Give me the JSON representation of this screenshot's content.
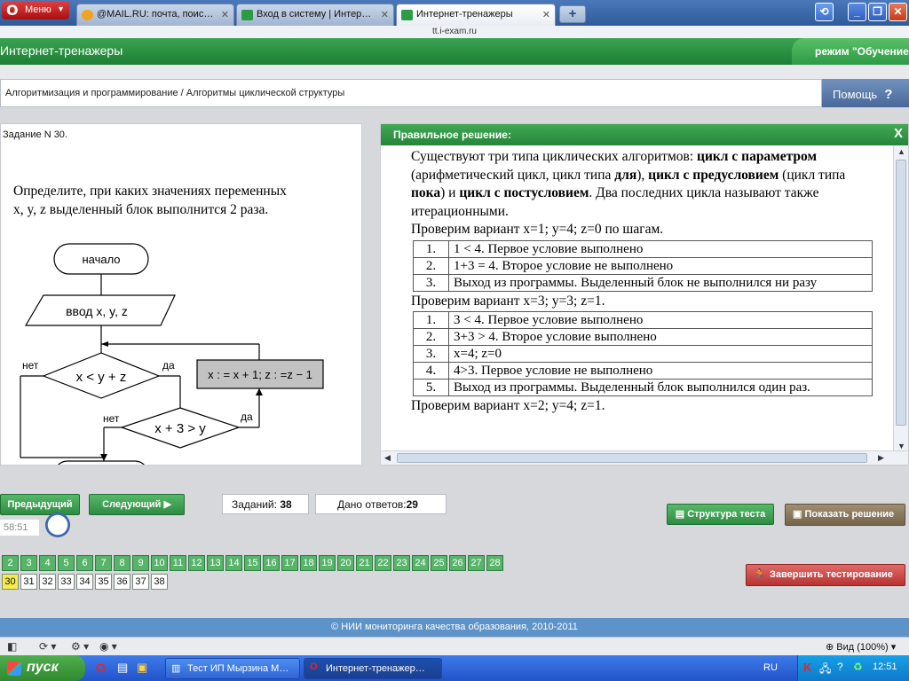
{
  "browser": {
    "menu_label": "Меню",
    "tabs": [
      {
        "label": "@MAIL.RU: почта, поис…",
        "icon": "mail-icon",
        "color": "#f1a21f"
      },
      {
        "label": "Вход в систему | Интер…",
        "icon": "exam-site-icon",
        "color": "#2e9a45"
      },
      {
        "label": "Интернет-тренажеры",
        "icon": "exam-site-icon",
        "color": "#2e9a45"
      }
    ],
    "new_tab": "+",
    "address": "tt.i-exam.ru"
  },
  "header": {
    "title": "Интернет-тренажеры",
    "mode": "режим \"Обучение\""
  },
  "breadcrumb": "Алгоритмизация и программирование / Алгоритмы циклической структуры",
  "help_label": "Помощь",
  "task": {
    "number": "Задание N 30.",
    "question": "Определите, при каких значениях переменных x, y, z выделенный блок выполнится 2 раза.",
    "flowchart": {
      "start": "начало",
      "input": "ввод  x, y, z",
      "cond1": "x < y + z",
      "cond2": "x + 3 > y",
      "block": "x : = x + 1; z : =z − 1",
      "yes": "да",
      "no": "нет"
    }
  },
  "solution": {
    "title": "Правильное решение:",
    "close": "X",
    "intro": "Существуют три типа циклических алгоритмов: цикл с параметром (арифметический цикл, цикл типа для), цикл с предусловием (цикл типа пока) и цикл с постусловием. Два последних цикла называют также итерационными.",
    "check1": "Проверим вариант x=1; y=4; z=0 по шагам.",
    "table1": [
      {
        "n": "1.",
        "text": "1 < 4. Первое условие выполнено"
      },
      {
        "n": "2.",
        "text": "1+3 = 4. Второе условие не выполнено"
      },
      {
        "n": "3.",
        "text": "Выход из программы. Выделенный блок не выполнился ни разу"
      }
    ],
    "check2": "Проверим вариант x=3; y=3; z=1.",
    "table2": [
      {
        "n": "1.",
        "text": "3 < 4. Первое условие выполнено"
      },
      {
        "n": "2.",
        "text": "3+3 > 4. Второе условие выполнено"
      },
      {
        "n": "3.",
        "text": "x=4; z=0"
      },
      {
        "n": "4.",
        "text": "4>3. Первое условие не выполнено"
      },
      {
        "n": "5.",
        "text": "Выход из программы. Выделенный блок выполнился один раз."
      }
    ],
    "check3": "Проверим вариант x=2; y=4; z=1."
  },
  "nav": {
    "prev": "Предыдущий",
    "next": "Следующий",
    "tasks_label": "Заданий:",
    "tasks_count": "38",
    "answers_label": "Дано ответов:",
    "answers_count": "29",
    "timer": "58:51",
    "structure": "Структура теста",
    "show_solution": "Показать решение",
    "finish": "Завершить тестирование"
  },
  "questions": {
    "row1": [
      "2",
      "3",
      "4",
      "5",
      "6",
      "7",
      "8",
      "9",
      "10",
      "11",
      "12",
      "13",
      "14",
      "15",
      "16",
      "17",
      "18",
      "19",
      "20",
      "21",
      "22",
      "23",
      "24",
      "25",
      "26",
      "27",
      "28"
    ],
    "row2": [
      "30",
      "31",
      "32",
      "33",
      "34",
      "35",
      "36",
      "37",
      "38"
    ],
    "current": "30"
  },
  "footer": "© НИИ мониторинга качества образования, 2010-2011",
  "statusbar": {
    "zoom": "Вид (100%)"
  },
  "taskbar": {
    "start": "пуск",
    "tasks": [
      "Тест ИП Мырзина М…",
      "Интернет-тренажер…"
    ],
    "lang": "RU",
    "time": "12:51"
  },
  "colors": {
    "header_green": "#2e9a45",
    "done_cell": "#57b46a",
    "current_cell": "#f4ed4a",
    "footer_blue": "#5d93c8"
  }
}
